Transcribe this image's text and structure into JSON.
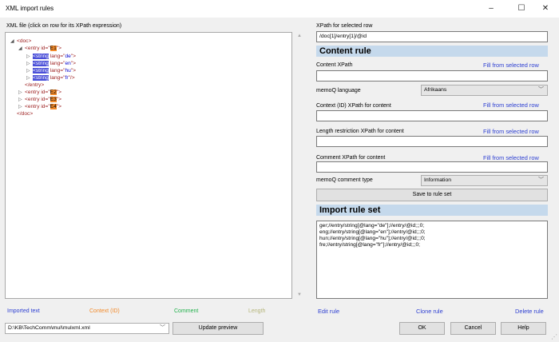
{
  "window": {
    "title": "XML import rules",
    "minimize": "–",
    "maximize": "☐",
    "close": "✕"
  },
  "left": {
    "caption": "XML file (click on row for its XPath expression)",
    "tree": [
      {
        "tw": "◢",
        "tag_open": "<doc>"
      },
      {
        "tw": "◢",
        "tag": "<entry ",
        "attr": "id=\"",
        "val": "E1",
        "end": "\">"
      },
      {
        "tw": "▷",
        "tag": "<string",
        "attr": " lang=\"",
        "val": "de",
        "end": "\">"
      },
      {
        "tw": "▷",
        "tag": "<string",
        "attr": " lang=\"",
        "val": "en",
        "end": "\">"
      },
      {
        "tw": "▷",
        "tag": "<string",
        "attr": " lang=\"",
        "val": "hu",
        "end": "\">"
      },
      {
        "tw": "▷",
        "tag": "<string",
        "attr": " lang=\"",
        "val": "fr",
        "end": "\"/>"
      },
      {
        "tw": "",
        "tag_open": "</entry>"
      },
      {
        "tw": "▷",
        "tag": "<entry ",
        "attr": "id=\"",
        "val": "E2",
        "end": "\">"
      },
      {
        "tw": "▷",
        "tag": "<entry ",
        "attr": "id=\"",
        "val": "E3",
        "end": "\">"
      },
      {
        "tw": "▷",
        "tag": "<entry ",
        "attr": "id=\"",
        "val": "E4",
        "end": "\">"
      },
      {
        "tw": "",
        "tag_open": "</doc>"
      }
    ],
    "legend": {
      "imported": "Imported text",
      "context": "Context (ID)",
      "comment": "Comment",
      "length": "Length"
    },
    "file_path": "D:\\KB\\TechComm\\mul\\mulxml.xml",
    "update_preview": "Update preview"
  },
  "right": {
    "xpath_label": "XPath for selected row",
    "xpath_value": "/doc[1]/entry[1]/@id",
    "content_rule_title": "Content rule",
    "content_xpath_label": "Content XPath",
    "fill_link": "Fill from selected row",
    "content_xpath_value": "",
    "memoq_language_label": "memoQ language",
    "memoq_language_value": "Afrikaans",
    "context_label": "Context (ID) XPath for content",
    "context_value": "",
    "length_label": "Length restriction XPath for content",
    "length_value": "",
    "comment_label": "Comment XPath for content",
    "comment_value": "",
    "comment_type_label": "memoQ comment type",
    "comment_type_value": "Information",
    "save_button": "Save to rule set",
    "import_rule_set_title": "Import rule set",
    "rules": [
      "ger;//entry/string[@lang=\"de\"];//entry/@id;;;0;",
      "eng;//entry/string[@lang=\"en\"];//entry/@id;;;0;",
      "hun;//entry/string[@lang=\"hu\"];//entry/@id;;;0;",
      "fre;//entry/string[@lang=\"fr\"];//entry/@id;;;0;"
    ],
    "edit_rule": "Edit rule",
    "clone_rule": "Clone rule",
    "delete_rule": "Delete rule"
  },
  "footer": {
    "ok": "OK",
    "cancel": "Cancel",
    "help": "Help"
  },
  "colors": {
    "imported": "#2d3fd2",
    "context": "#f28a2a",
    "comment": "#22b14c",
    "length": "#b5b57a",
    "section_bg": "#c5d9ec"
  }
}
